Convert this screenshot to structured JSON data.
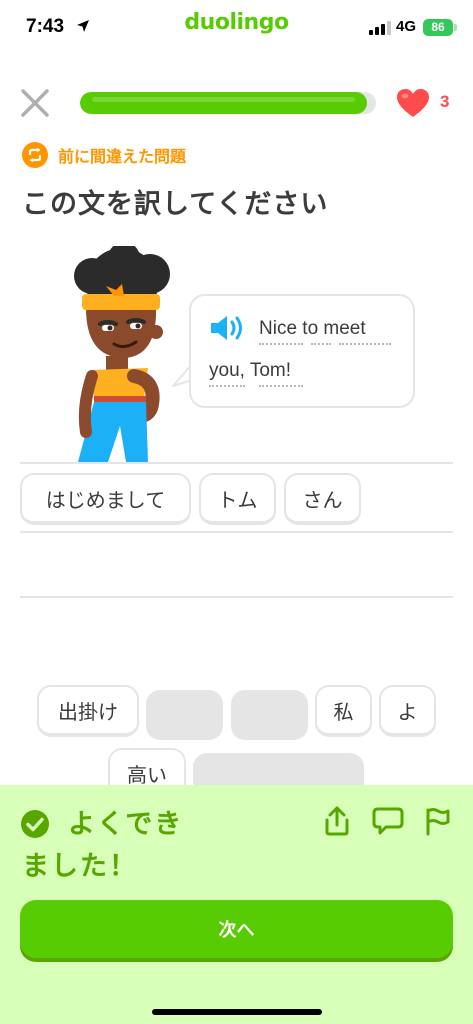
{
  "status_bar": {
    "time": "7:43",
    "network": "4G",
    "battery": "86",
    "location_icon": "location-arrow-icon",
    "signal_icon": "cellular-signal-icon"
  },
  "brand": {
    "name": "duolingo",
    "color": "#58cc02"
  },
  "lesson": {
    "progress": 0.97,
    "hearts": "3",
    "close_icon": "close-icon",
    "heart_icon": "heart-icon"
  },
  "review_badge": {
    "label": "前に間違えた問題",
    "icon": "repeat-icon",
    "color": "#ff9600"
  },
  "prompt": {
    "title": "この文を訳してください"
  },
  "speech_bubble": {
    "line1": "Nice to meet",
    "line2": "you, Tom!",
    "icon": "speaker-icon"
  },
  "answer": {
    "tiles": [
      "はじめまして",
      "トム",
      "さん"
    ]
  },
  "word_bank": {
    "tiles": [
      {
        "label": "出掛け",
        "used": false
      },
      {
        "label": "",
        "used": true
      },
      {
        "label": "",
        "used": true
      },
      {
        "label": "私",
        "used": false
      },
      {
        "label": "よ",
        "used": false
      },
      {
        "label": "高い",
        "used": false
      },
      {
        "label": "",
        "used": true
      }
    ]
  },
  "feedback": {
    "title": "よくできました！",
    "icons": [
      "check-circle-icon",
      "share-icon",
      "comment-icon",
      "flag-icon"
    ],
    "background": "#d7ffb8",
    "text_color": "#58a700"
  },
  "continue_button": {
    "label": "次へ",
    "color": "#58cc02"
  },
  "colors": {
    "accent": "#58cc02",
    "heart": "#ff4b4b",
    "speaker": "#1cb0f6"
  }
}
